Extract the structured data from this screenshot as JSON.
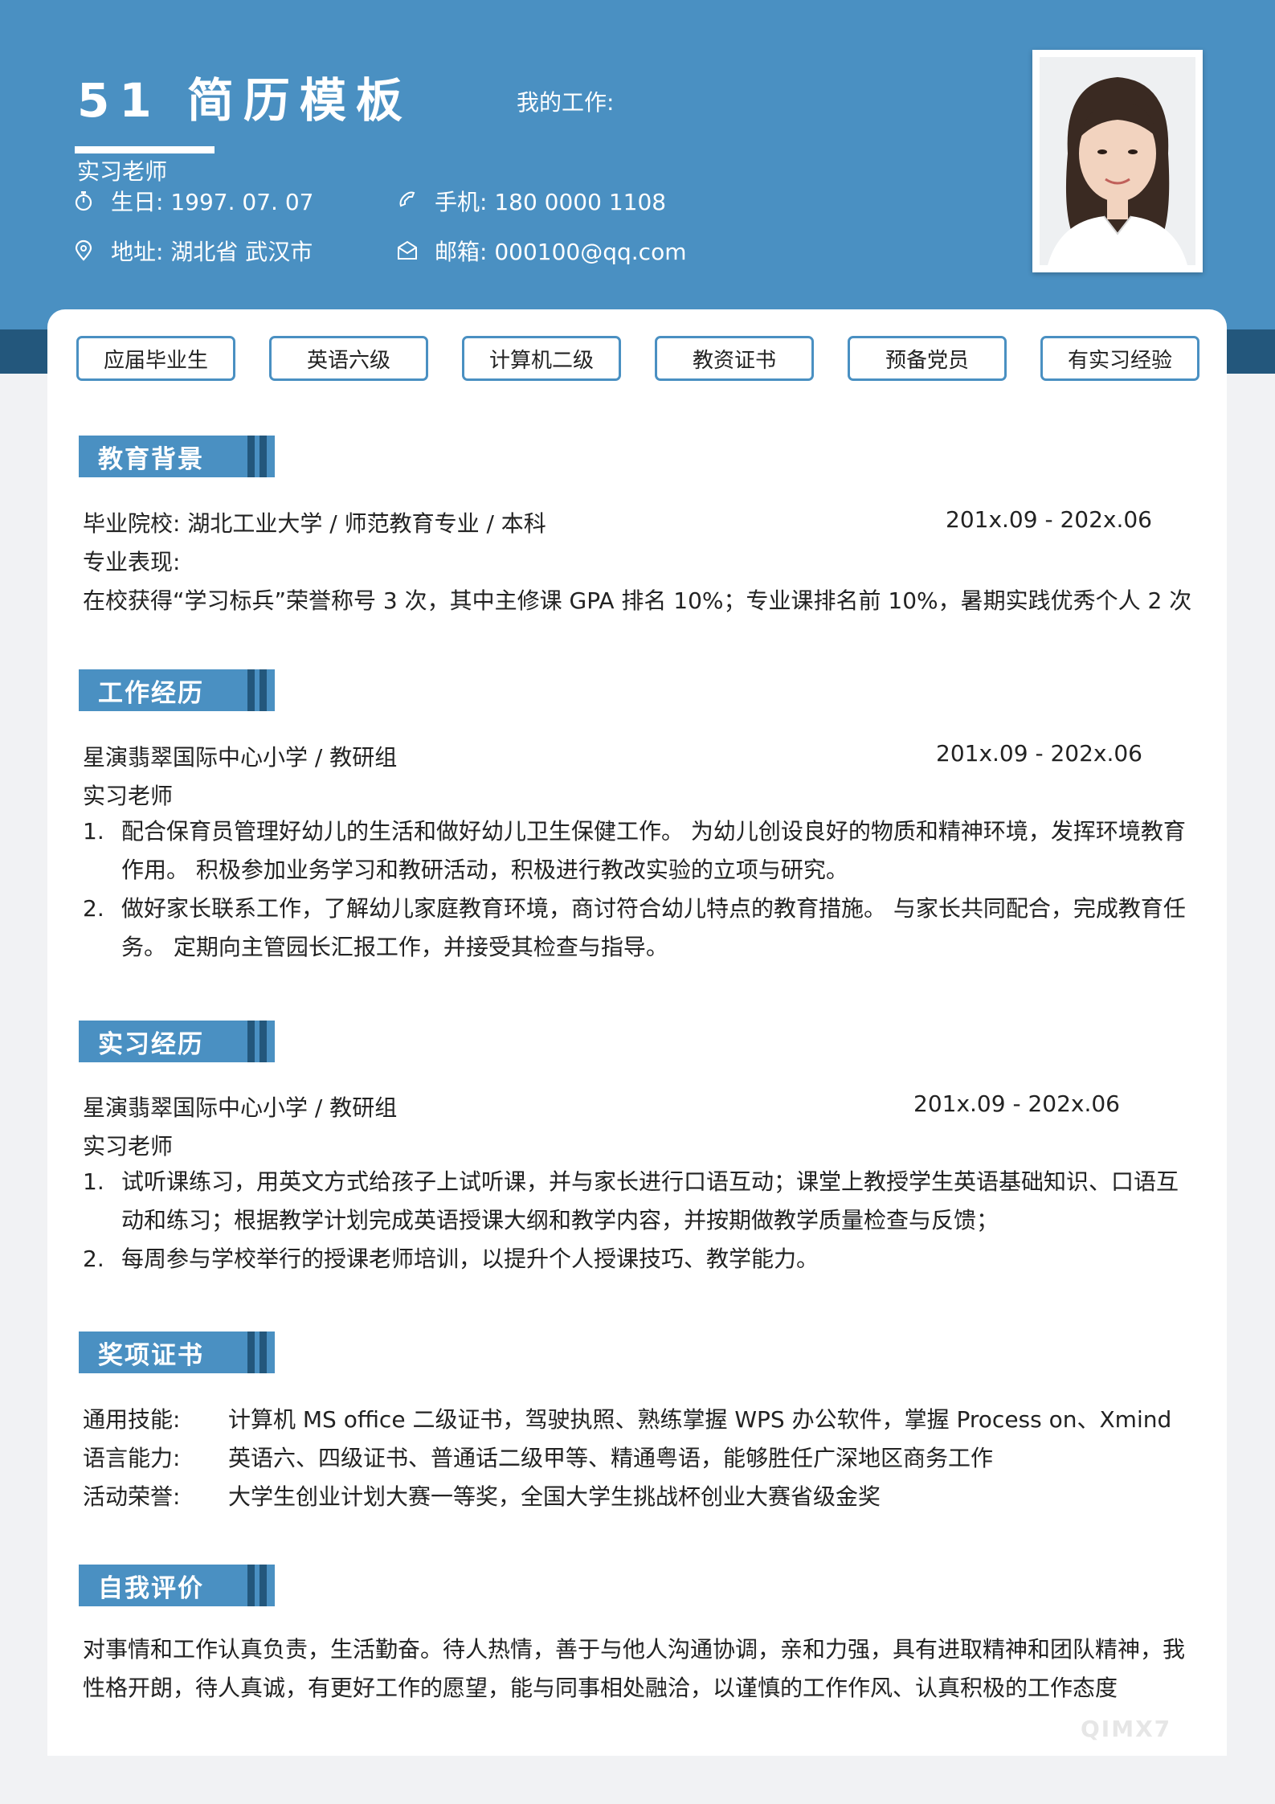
{
  "header": {
    "name": "51 简历模板",
    "job_label": "我的工作:",
    "role": "实习老师",
    "birthday": "生日: 1997. 07. 07",
    "phone": "手机: 180 0000 1108",
    "address": "地址: 湖北省  武汉市",
    "email": "邮箱: 000100@qq.com"
  },
  "tags": [
    "应届毕业生",
    "英语六级",
    "计算机二级",
    "教资证书",
    "预备党员",
    "有实习经验"
  ],
  "education": {
    "title": "教育背景",
    "school": "毕业院校: 湖北工业大学 / 师范教育专业 / 本科",
    "date": "201x.09 - 202x.06",
    "performance_label": "专业表现:",
    "performance": "在校获得“学习标兵”荣誉称号 3 次，其中主修课 GPA 排名 10%；专业课排名前 10%，暑期实践优秀个人 2 次"
  },
  "work": {
    "title": "工作经历",
    "org": "星演翡翠国际中心小学 / 教研组",
    "date": "201x.09 - 202x.06",
    "role": "实习老师",
    "items": [
      {
        "num": "1.",
        "text": "配合保育员管理好幼儿的生活和做好幼儿卫生保健工作。 为幼儿创设良好的物质和精神环境，发挥环境教育作用。 积极参加业务学习和教研活动，积极进行教改实验的立项与研究。"
      },
      {
        "num": "2.",
        "text": "做好家长联系工作，了解幼儿家庭教育环境，商讨符合幼儿特点的教育措施。 与家长共同配合，完成教育任务。 定期向主管园长汇报工作，并接受其检查与指导。"
      }
    ]
  },
  "intern": {
    "title": "实习经历",
    "org": "星演翡翠国际中心小学 / 教研组",
    "date": "201x.09 - 202x.06",
    "role": "实习老师",
    "items": [
      {
        "num": "1.",
        "text": "试听课练习，用英文方式给孩子上试听课，并与家长进行口语互动；课堂上教授学生英语基础知识、口语互动和练习；根据教学计划完成英语授课大纲和教学内容，并按期做教学质量检查与反馈；"
      },
      {
        "num": "2.",
        "text": "每周参与学校举行的授课老师培训，以提升个人授课技巧、教学能力。"
      }
    ]
  },
  "awards": {
    "title": "奖项证书",
    "rows": [
      {
        "k": "通用技能:",
        "v": "计算机 MS office 二级证书，驾驶执照、熟练掌握 WPS 办公软件，掌握 Process on、Xmind"
      },
      {
        "k": "语言能力:",
        "v": "英语六、四级证书、普通话二级甲等、精通粤语，能够胜任广深地区商务工作"
      },
      {
        "k": "活动荣誉:",
        "v": "大学生创业计划大赛一等奖，全国大学生挑战杯创业大赛省级金奖"
      }
    ]
  },
  "self": {
    "title": "自我评价",
    "text": "对事情和工作认真负责，生活勤奋。待人热情，善于与他人沟通协调，亲和力强，具有进取精神和团队精神，我性格开朗，待人真诚，有更好工作的愿望，能与同事相处融洽，以谨慎的工作作风、认真积极的工作态度"
  },
  "watermark": "QIMX7",
  "colors": {
    "primary": "#4a90c2",
    "dark": "#23577c"
  }
}
